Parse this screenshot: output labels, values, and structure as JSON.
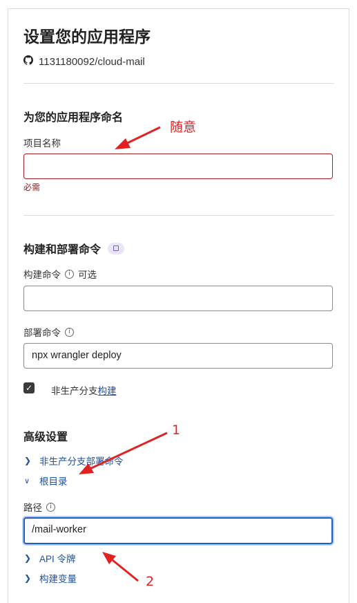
{
  "page": {
    "title": "设置您的应用程序",
    "repo": "1131180092/cloud-mail"
  },
  "naming": {
    "section_title": "为您的应用程序命名",
    "project_name_label": "项目名称",
    "project_name_value": "",
    "required_text": "必需"
  },
  "build": {
    "section_title": "构建和部署命令",
    "build_command_label": "构建命令",
    "optional_text": "可选",
    "build_command_value": "",
    "deploy_command_label": "部署命令",
    "deploy_command_value": "npx wrangler deploy",
    "non_production_label": "非生产分支",
    "non_production_link": "构建",
    "non_production_checked": true
  },
  "advanced": {
    "section_title": "高级设置",
    "items": [
      {
        "label": "非生产分支部署命令",
        "expanded": false
      },
      {
        "label": "根目录",
        "expanded": true
      }
    ],
    "path_label": "路径",
    "path_value": "/mail-worker",
    "more_items": [
      {
        "label": "API 令牌",
        "expanded": false
      },
      {
        "label": "构建变量",
        "expanded": false
      }
    ]
  },
  "annotations": {
    "note_random": "随意",
    "marker_1": "1",
    "marker_2": "2",
    "color": "#e02222"
  },
  "icons": {
    "repo": "github-icon",
    "info": "info-icon",
    "docs": "book-icon",
    "collapsed": "chevron-right-icon",
    "expanded": "chevron-down-icon"
  }
}
